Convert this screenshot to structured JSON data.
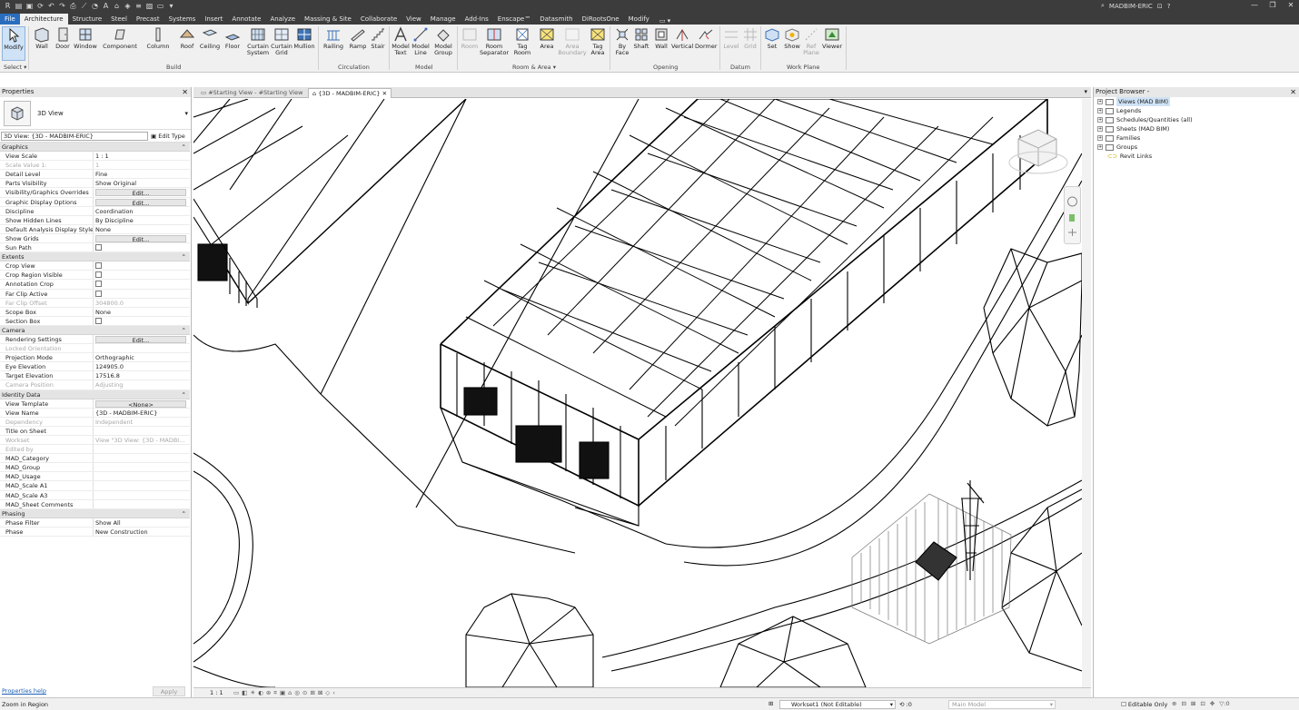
{
  "titlebar": {
    "user": "MADBIM-ERIC",
    "qat_icons": [
      "revit-logo-icon",
      "open-icon",
      "save-icon",
      "sync-icon",
      "undo-icon",
      "redo-icon",
      "print-icon",
      "measure-icon",
      "tag-icon",
      "text-icon",
      "3d-view-icon",
      "section-icon",
      "thin-lines-icon",
      "close-hidden-icon",
      "switch-windows-icon",
      "customize-icon"
    ]
  },
  "tabs": [
    "File",
    "Architecture",
    "Structure",
    "Steel",
    "Precast",
    "Systems",
    "Insert",
    "Annotate",
    "Analyze",
    "Massing & Site",
    "Collaborate",
    "View",
    "Manage",
    "Add-Ins",
    "Enscape™",
    "Datasmith",
    "DiRootsOne",
    "Modify"
  ],
  "tab_extra": "▭ ▾",
  "ribbon": {
    "select": {
      "modify": "Modify",
      "label": "Select ▾"
    },
    "build": {
      "label": "Build",
      "items": [
        "Wall",
        "Door",
        "Window",
        "Component",
        "Column",
        "Roof",
        "Ceiling",
        "Floor",
        "Curtain System",
        "Curtain Grid",
        "Mullion"
      ]
    },
    "circulation": {
      "label": "Circulation",
      "items": [
        "Railing",
        "Ramp",
        "Stair"
      ]
    },
    "model": {
      "label": "Model",
      "items": [
        "Model Text",
        "Model Line",
        "Model Group"
      ]
    },
    "room_area": {
      "label": "Room & Area ▾",
      "items": [
        "Room",
        "Room Separator",
        "Tag Room",
        "Area",
        "Area Boundary",
        "Tag Area"
      ]
    },
    "opening": {
      "label": "Opening",
      "items": [
        "By Face",
        "Shaft",
        "Wall",
        "Vertical",
        "Dormer"
      ]
    },
    "datum": {
      "label": "Datum",
      "items": [
        "Level",
        "Grid"
      ]
    },
    "work_plane": {
      "label": "Work Plane",
      "items": [
        "Set",
        "Show",
        "Ref Plane",
        "Viewer"
      ]
    }
  },
  "properties": {
    "title": "Properties",
    "type_name": "3D View",
    "selector": "3D View: {3D - MADBIM-ERIC}",
    "edit_type": "Edit Type",
    "groups": [
      {
        "name": "Graphics",
        "rows": [
          {
            "n": "View Scale",
            "v": "1 : 1"
          },
          {
            "n": "Scale Value    1:",
            "v": "1",
            "ro": true
          },
          {
            "n": "Detail Level",
            "v": "Fine"
          },
          {
            "n": "Parts Visibility",
            "v": "Show Original"
          },
          {
            "n": "Visibility/Graphics Overrides",
            "v": "Edit...",
            "btn": true
          },
          {
            "n": "Graphic Display Options",
            "v": "Edit...",
            "btn": true
          },
          {
            "n": "Discipline",
            "v": "Coordination"
          },
          {
            "n": "Show Hidden Lines",
            "v": "By Discipline"
          },
          {
            "n": "Default Analysis Display Style",
            "v": "None"
          },
          {
            "n": "Show Grids",
            "v": "Edit...",
            "btn": true
          },
          {
            "n": "Sun Path",
            "v": "",
            "chk": true
          }
        ]
      },
      {
        "name": "Extents",
        "rows": [
          {
            "n": "Crop View",
            "v": "",
            "chk": true
          },
          {
            "n": "Crop Region Visible",
            "v": "",
            "chk": true
          },
          {
            "n": "Annotation Crop",
            "v": "",
            "chk": true
          },
          {
            "n": "Far Clip Active",
            "v": "",
            "chk": true
          },
          {
            "n": "Far Clip Offset",
            "v": "304800.0",
            "ro": true
          },
          {
            "n": "Scope Box",
            "v": "None"
          },
          {
            "n": "Section Box",
            "v": "",
            "chk": true
          }
        ]
      },
      {
        "name": "Camera",
        "rows": [
          {
            "n": "Rendering Settings",
            "v": "Edit...",
            "btn": true
          },
          {
            "n": "Locked Orientation",
            "v": "",
            "ro": true
          },
          {
            "n": "Projection Mode",
            "v": "Orthographic"
          },
          {
            "n": "Eye Elevation",
            "v": "124905.0"
          },
          {
            "n": "Target Elevation",
            "v": "17516.8"
          },
          {
            "n": "Camera Position",
            "v": "Adjusting",
            "ro": true
          }
        ]
      },
      {
        "name": "Identity Data",
        "rows": [
          {
            "n": "View Template",
            "v": "<None>",
            "btn": true
          },
          {
            "n": "View Name",
            "v": "{3D - MADBIM-ERIC}"
          },
          {
            "n": "Dependency",
            "v": "Independent",
            "ro": true
          },
          {
            "n": "Title on Sheet",
            "v": ""
          },
          {
            "n": "Workset",
            "v": "View \"3D View: {3D - MADBI...",
            "ro": true
          },
          {
            "n": "Edited by",
            "v": "",
            "ro": true
          },
          {
            "n": "MAD_Category",
            "v": ""
          },
          {
            "n": "MAD_Group",
            "v": ""
          },
          {
            "n": "MAD_Usage",
            "v": ""
          },
          {
            "n": "MAD_Scale A1",
            "v": ""
          },
          {
            "n": "MAD_Scale A3",
            "v": ""
          },
          {
            "n": "MAD_Sheet Comments",
            "v": ""
          }
        ]
      },
      {
        "name": "Phasing",
        "rows": [
          {
            "n": "Phase Filter",
            "v": "Show All"
          },
          {
            "n": "Phase",
            "v": "New Construction"
          }
        ]
      }
    ],
    "help": "Properties help",
    "apply": "Apply"
  },
  "doc_tabs": [
    {
      "label": "#Starting View - #Starting View",
      "active": false
    },
    {
      "label": "{3D - MADBIM-ERIC}",
      "active": true
    }
  ],
  "viewbar": {
    "scale": "1 : 1"
  },
  "browser": {
    "title": "Project Browser -",
    "nodes": [
      "Views (MAD BIM)",
      "Legends",
      "Schedules/Quantities (all)",
      "Sheets (MAD BIM)",
      "Families",
      "Groups",
      "Revit Links"
    ]
  },
  "statusbar": {
    "message": "Zoom in Region",
    "workset": "Workset1 (Not Editable)",
    "zero": ":0",
    "model": "Main Model",
    "editable_only": "Editable Only",
    "filter_count": ":0"
  },
  "colors": {
    "file_tab": "#2a6dbf",
    "titlebar": "#3c3c3c",
    "ribbon": "#f0f0f0",
    "selection": "#cfe2f6"
  }
}
